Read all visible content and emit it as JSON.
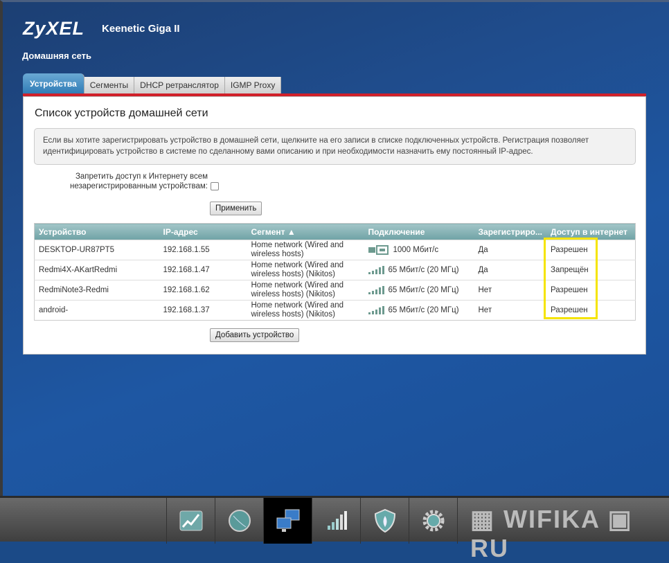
{
  "header": {
    "brand": "ZyXEL",
    "model": "Keenetic Giga II",
    "section": "Домашняя сеть"
  },
  "tabs": [
    {
      "label": "Устройства",
      "active": true
    },
    {
      "label": "Сегменты"
    },
    {
      "label": "DHCP ретранслятор"
    },
    {
      "label": "IGMP Proxy"
    }
  ],
  "panel": {
    "title": "Список устройств домашней сети",
    "info": "Если вы хотите зарегистрировать устройство в домашней сети, щелкните на его записи в списке подключенных устройств. Регистрация позволяет идентифицировать устройство в системе по сделанному вами описанию и при необходимости назначить ему постоянный IP-адрес.",
    "block_label": "Запретить доступ к Интернету всем незарегистрированным устройствам:",
    "block_checked": false,
    "apply_label": "Применить",
    "add_label": "Добавить устройство"
  },
  "table": {
    "columns": [
      "Устройство",
      "IP-адрес",
      "Сегмент ▲",
      "Подключение",
      "Зарегистриро...",
      "Доступ в интернет"
    ],
    "rows": [
      {
        "device": "DESKTOP-UR87PT5",
        "ip": "192.168.1.55",
        "segment": "Home network (Wired and wireless hosts)",
        "conn_icon": "ethernet-icon",
        "conn": "1000 Мбит/с",
        "registered": "Да",
        "access": "Разрешен"
      },
      {
        "device": "Redmi4X-AKartRedmi",
        "ip": "192.168.1.47",
        "segment": "Home network (Wired and wireless hosts) (Nikitos)",
        "conn_icon": "wifi-signal-icon",
        "conn": "65 Мбит/с (20 МГц)",
        "registered": "Да",
        "access": "Запрещён"
      },
      {
        "device": "RedmiNote3-Redmi",
        "ip": "192.168.1.62",
        "segment": "Home network (Wired and wireless hosts) (Nikitos)",
        "conn_icon": "wifi-signal-icon",
        "conn": "65 Мбит/с (20 МГц)",
        "registered": "Нет",
        "access": "Разрешен"
      },
      {
        "device": "android-",
        "ip": "192.168.1.37",
        "segment": "Home network (Wired and wireless hosts) (Nikitos)",
        "conn_icon": "wifi-signal-icon",
        "conn": "65 Мбит/с (20 МГц)",
        "registered": "Нет",
        "access": "Разрешен"
      }
    ]
  },
  "bottom_nav": [
    {
      "icon": "monitor-chart-icon"
    },
    {
      "icon": "globe-icon"
    },
    {
      "icon": "home-network-icon",
      "active": true
    },
    {
      "icon": "wifi-signal-icon"
    },
    {
      "icon": "firewall-shield-icon"
    },
    {
      "icon": "gear-icon"
    }
  ],
  "watermark": "WIFIKA.RU",
  "colors": {
    "accent_red": "#d0202a",
    "highlight": "#f5e400",
    "table_header": "#7fabad"
  }
}
